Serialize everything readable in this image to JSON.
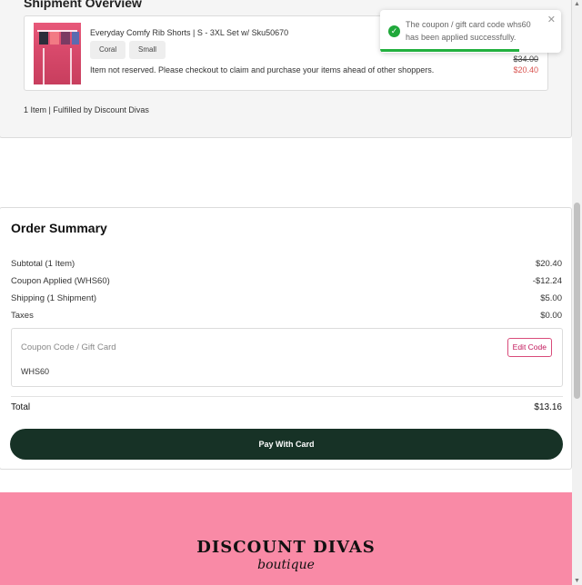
{
  "shipment": {
    "title": "Shipment Overview",
    "item": {
      "name": "Everyday Comfy Rib Shorts | S - 3XL Set w/ Sku50670",
      "color_option": "Coral",
      "size_option": "Small",
      "reserve_message": "Item not reserved. Please checkout to claim and purchase your items ahead of other shoppers.",
      "original_price": "$34.00",
      "sale_price": "$20.40"
    },
    "footer": "1 Item | Fulfilled by Discount Divas"
  },
  "toast": {
    "message": "The coupon / gift card code whs60 has been applied successfully.",
    "close_glyph": "✕",
    "check_glyph": "✓",
    "progress_fraction": 0.77
  },
  "summary": {
    "title": "Order Summary",
    "subtotal_label": "Subtotal (1 Item)",
    "subtotal_value": "$20.40",
    "coupon_label": "Coupon Applied (WHS60)",
    "coupon_value": "-$12.24",
    "shipping_label": "Shipping (1 Shipment)",
    "shipping_value": "$5.00",
    "taxes_label": "Taxes",
    "taxes_value": "$0.00",
    "coupon_field_label": "Coupon Code / Gift Card",
    "edit_code_label": "Edit Code",
    "coupon_code": "WHS60",
    "total_label": "Total",
    "total_value": "$13.16",
    "pay_button_label": "Pay With Card"
  },
  "brand": {
    "name": "DISCOUNT DIVAS",
    "tagline": "boutique",
    "band_color": "#f98aa6"
  },
  "colors": {
    "pay_button": "#173226",
    "success": "#1fa83a",
    "sale_price": "#d9534f",
    "edit_code": "#c2185b"
  },
  "scrollbar": {
    "up_glyph": "▲",
    "down_glyph": "▼"
  }
}
